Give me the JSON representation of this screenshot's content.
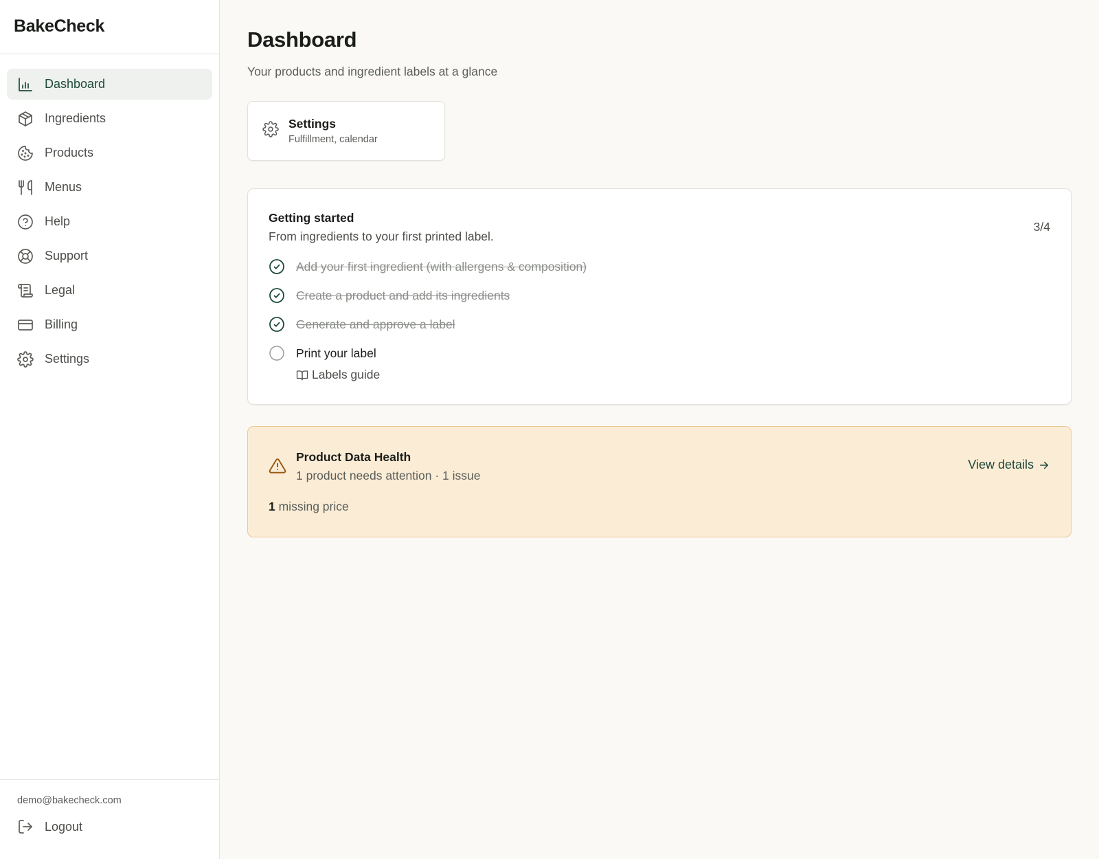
{
  "app": {
    "name": "BakeCheck"
  },
  "sidebar": {
    "items": [
      {
        "label": "Dashboard",
        "icon": "bar-chart-icon",
        "active": true
      },
      {
        "label": "Ingredients",
        "icon": "package-icon"
      },
      {
        "label": "Products",
        "icon": "cookie-icon"
      },
      {
        "label": "Menus",
        "icon": "utensils-icon"
      },
      {
        "label": "Help",
        "icon": "help-circle-icon"
      },
      {
        "label": "Support",
        "icon": "life-buoy-icon"
      },
      {
        "label": "Legal",
        "icon": "scroll-icon"
      },
      {
        "label": "Billing",
        "icon": "credit-card-icon"
      },
      {
        "label": "Settings",
        "icon": "gear-icon"
      }
    ],
    "footer": {
      "email": "demo@bakecheck.com",
      "logout_label": "Logout"
    }
  },
  "main": {
    "title": "Dashboard",
    "subtitle": "Your products and ingredient labels at a glance",
    "settings_card": {
      "title": "Settings",
      "description": "Fulfillment, calendar"
    },
    "getting_started": {
      "title": "Getting started",
      "subtitle": "From ingredients to your first printed label.",
      "progress": "3/4",
      "steps": [
        {
          "label": "Add your first ingredient (with allergens & composition)",
          "done": true
        },
        {
          "label": "Create a product and add its ingredients",
          "done": true
        },
        {
          "label": "Generate and approve a label",
          "done": true
        },
        {
          "label": "Print your label",
          "done": false
        }
      ],
      "guide_link": "Labels guide"
    },
    "health": {
      "title": "Product Data Health",
      "summary": "1 product needs attention · 1 issue",
      "view_details": "View details",
      "stat_count": "1",
      "stat_label": "missing price"
    }
  },
  "colors": {
    "accent": "#1f4a3c",
    "warning_bg": "#fbecd6",
    "warning_border": "#ecc894",
    "warning_icon": "#9a5a12"
  }
}
